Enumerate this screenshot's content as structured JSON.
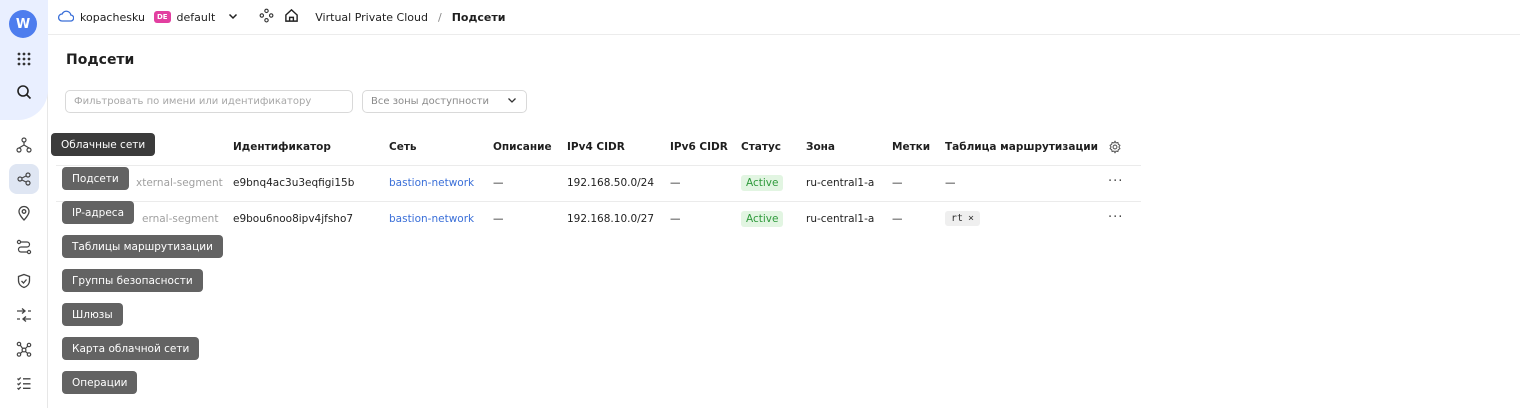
{
  "rail": {
    "logo": "W",
    "items": [
      "apps-icon",
      "search-icon",
      "cloud-networks-icon",
      "subnets-icon",
      "ip-addresses-icon",
      "route-tables-icon",
      "security-groups-icon",
      "gateways-icon",
      "network-map-icon",
      "operations-icon"
    ]
  },
  "topbar": {
    "cloud": "kopachesku",
    "folder_badge": "DE",
    "folder": "default",
    "service": "Virtual Private Cloud",
    "separator": "/",
    "current": "Подсети"
  },
  "page": {
    "title": "Подсети",
    "filter_placeholder": "Фильтровать по имени или идентификатору",
    "zone_select": "Все зоны доступности"
  },
  "table": {
    "headers": [
      "Идентификатор",
      "Сеть",
      "Описание",
      "IPv4 CIDR",
      "IPv6 CIDR",
      "Статус",
      "Зона",
      "Метки",
      "Таблица маршрутизации"
    ],
    "rows": [
      {
        "name": "xternal-segment",
        "id": "e9bnq4ac3u3eqfigi15b",
        "network": "bastion-network",
        "description": "—",
        "ipv4": "192.168.50.0/24",
        "ipv6": "—",
        "status": "Active",
        "zone": "ru-central1-a",
        "labels": "—",
        "route_table": "—"
      },
      {
        "name": "ernal-segment",
        "id": "e9bou6noo8ipv4jfsho7",
        "network": "bastion-network",
        "description": "—",
        "ipv4": "192.168.10.0/27",
        "ipv6": "—",
        "status": "Active",
        "zone": "ru-central1-a",
        "labels": "—",
        "route_table": "rt"
      }
    ],
    "more": "···",
    "chip_close": "×"
  },
  "tooltips": [
    "Облачные сети",
    "Подсети",
    "IP-адреса",
    "Таблицы маршрутизации",
    "Группы безопасности",
    "Шлюзы",
    "Карта облачной сети",
    "Операции"
  ],
  "colors": {
    "accent": "#4e7dee",
    "link": "#3a6fd8",
    "active_bg": "#e2f5e2",
    "active_text": "#2f9a3c",
    "badge": "#e23fa0"
  }
}
